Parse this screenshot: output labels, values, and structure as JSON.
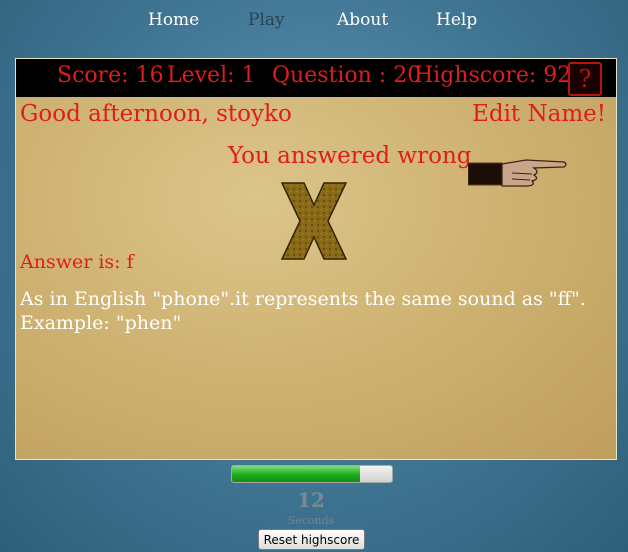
{
  "nav": {
    "home": "Home",
    "play": "Play",
    "about": "About",
    "help": "Help"
  },
  "scorebar": {
    "score": "Score: 16",
    "level": "Level: 1",
    "question": "Question : 20",
    "highscore": "Highscore: 92",
    "help_icon": "?"
  },
  "greeting": "Good afternoon, stoyko",
  "edit_name": "Edit Name!",
  "result_message": "You answered wrong",
  "answer": "Answer is: f",
  "explanation": {
    "line1": "As in English \"phone\".it represents the same sound as \"ff\".",
    "line2": "Example: \"phen\""
  },
  "timer": {
    "progress_fraction": 0.8,
    "seconds_value": "12",
    "seconds_label": "Seconds"
  },
  "reset_button": "Reset highscore",
  "icons": {
    "pointer": "pointing-hand-icon",
    "wrong": "x-mark-icon",
    "help": "question-mark-icon"
  },
  "colors": {
    "accent_red": "#e11c1c",
    "progress_green": "#22b022"
  }
}
